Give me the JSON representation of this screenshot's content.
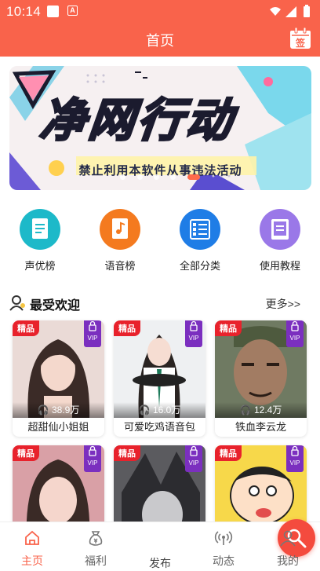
{
  "status_bar": {
    "time": "10:14"
  },
  "header": {
    "title": "首页",
    "sign_label": "签"
  },
  "banner": {
    "title": "净网行动",
    "subtitle": "禁止利用本软件从事违法活动",
    "slide_count": 5,
    "active_slide": 5
  },
  "categories": [
    {
      "label": "声优榜",
      "icon": "document-icon",
      "color": "#1db9c9"
    },
    {
      "label": "语音榜",
      "icon": "audio-doc-icon",
      "color": "#f47a1f"
    },
    {
      "label": "全部分类",
      "icon": "list-icon",
      "color": "#1f7de6"
    },
    {
      "label": "使用教程",
      "icon": "book-icon",
      "color": "#9a78e8"
    }
  ],
  "popular": {
    "title": "最受欢迎",
    "more_label": "更多>>",
    "badge_label": "精品",
    "vip_label": "VIP",
    "items": [
      {
        "plays": "38.9万",
        "name": "超甜仙小姐姐"
      },
      {
        "plays": "16.0万",
        "name": "可爱吃鸡语音包"
      },
      {
        "plays": "12.4万",
        "name": "铁血李云龙"
      },
      {
        "plays": "",
        "name": ""
      },
      {
        "plays": "",
        "name": ""
      },
      {
        "plays": "",
        "name": ""
      }
    ]
  },
  "nav": {
    "items": [
      {
        "label": "主页",
        "icon": "home-icon",
        "active": true
      },
      {
        "label": "福利",
        "icon": "money-bag-icon",
        "active": false
      },
      {
        "label": "发布",
        "icon": "microphone-icon",
        "active": false
      },
      {
        "label": "动态",
        "icon": "broadcast-icon",
        "active": false
      },
      {
        "label": "我的",
        "icon": "user-icon",
        "active": false
      }
    ]
  },
  "colors": {
    "primary": "#f9634b",
    "badge": "#e8222c",
    "vip": "#7b2fbf"
  }
}
